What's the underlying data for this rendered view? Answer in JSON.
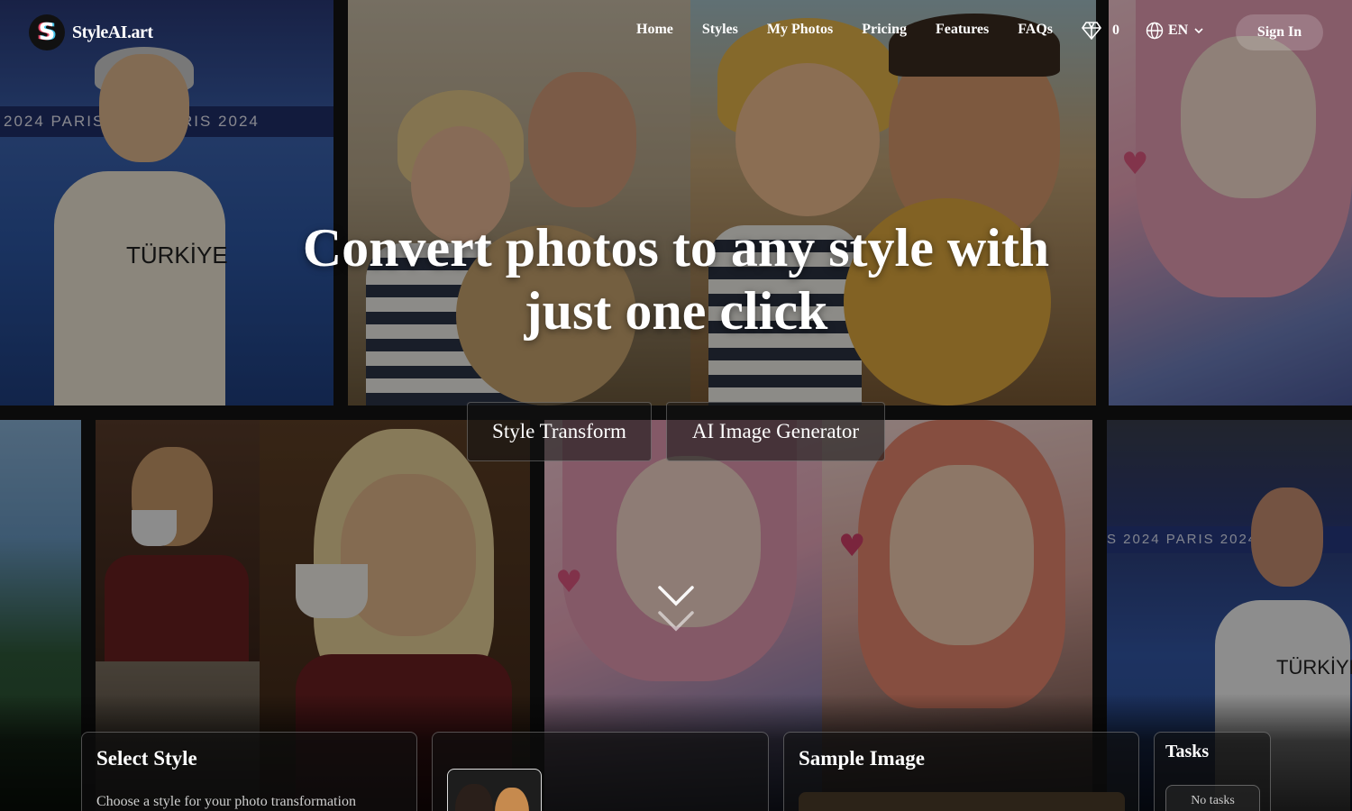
{
  "brand": {
    "name": "StyleAI.art",
    "logo_letter": "S"
  },
  "nav": {
    "links": [
      "Home",
      "Styles",
      "My Photos",
      "Pricing",
      "Features",
      "FAQs"
    ],
    "credits": "0",
    "language": "EN",
    "sign_in": "Sign In"
  },
  "hero": {
    "title_line1": "Convert photos to any style with",
    "title_line2": "just one click",
    "mode_style_transform": "Style Transform",
    "mode_ai_generator": "AI Image Generator"
  },
  "background_text": {
    "tile1_band": "2024  PARIS 2024  PARIS 2024",
    "tile1_brand": "TÜRKİYE",
    "tile10_band": "S 2024  PARIS 2024  202",
    "tile10_brand": "TÜRKİYE"
  },
  "panels": {
    "select_style": {
      "title": "Select Style",
      "subtitle": "Choose a style for your photo transformation"
    },
    "sample_image": {
      "title": "Sample Image"
    },
    "tasks": {
      "title": "Tasks",
      "empty": "No tasks"
    }
  }
}
